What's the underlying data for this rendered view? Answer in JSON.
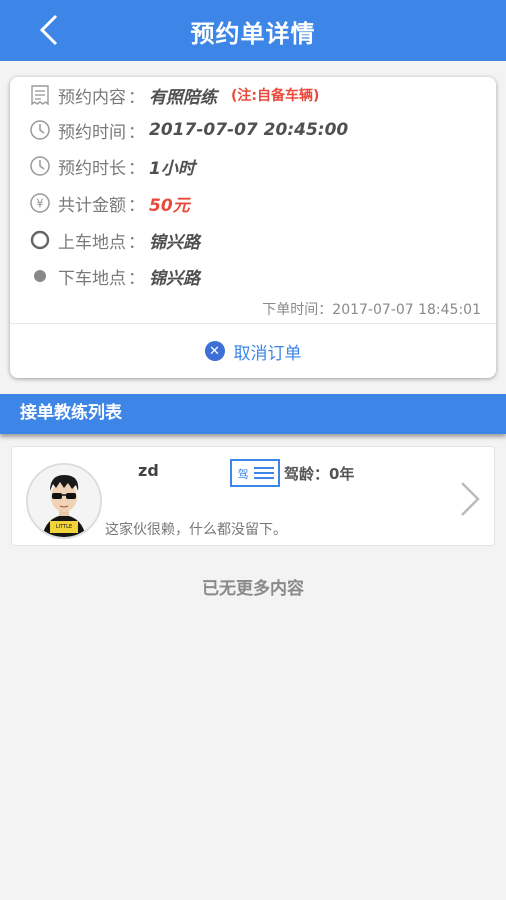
{
  "header": {
    "title": "预约单详情",
    "back_icon": "chevron-left-icon"
  },
  "order": {
    "content": {
      "label": "预约内容",
      "sep": "：",
      "value": "有照陪练",
      "note": "(注:自备车辆)"
    },
    "time": {
      "label": "预约时间",
      "sep": "：",
      "value": "2017-07-07 20:45:00"
    },
    "duration": {
      "label": "预约时长",
      "sep": "：",
      "value": "1小时"
    },
    "amount": {
      "label": "共计金额",
      "sep": "：",
      "value": "50元"
    },
    "pickup": {
      "label": "上车地点",
      "sep": "：",
      "value": "锦兴路"
    },
    "dropoff": {
      "label": "下车地点",
      "sep": "：",
      "value": "锦兴路"
    },
    "order_time": "下单时间：2017-07-07 18:45:01",
    "cancel_label": "取消订单"
  },
  "coaches": {
    "section_title": "接单教练列表",
    "items": [
      {
        "name": "zd",
        "drive_age": "驾龄：0年",
        "bio": "这家伙很赖，什么都没留下。",
        "license_text": "驾"
      }
    ],
    "end_text": "已无更多内容"
  },
  "colors": {
    "primary": "#3d85e6",
    "accent_red": "#e84b3c",
    "background": "#f3f3f3"
  }
}
